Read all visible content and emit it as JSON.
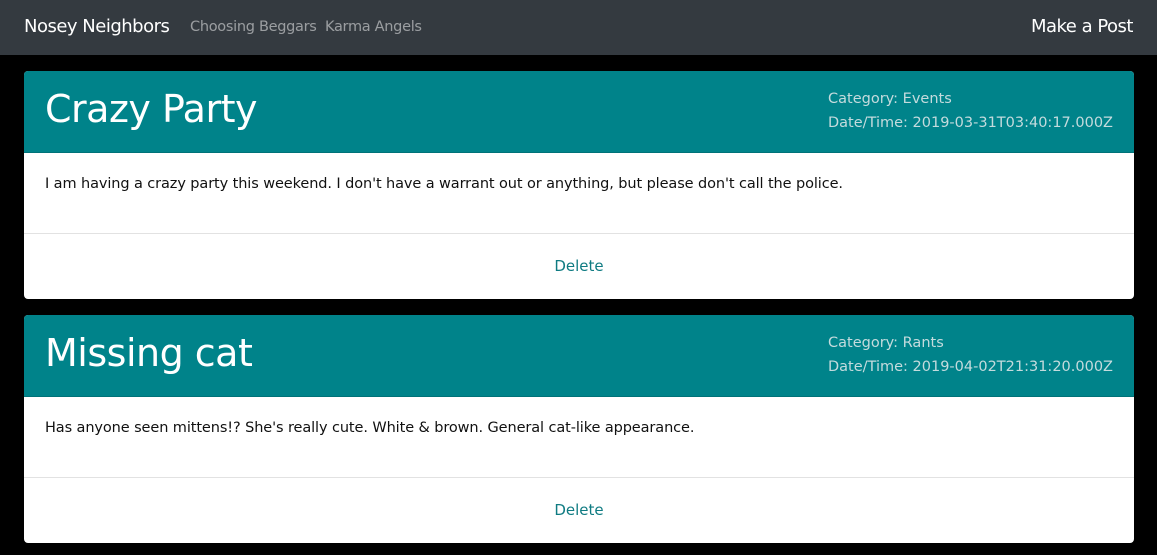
{
  "navbar": {
    "brand": "Nosey Neighbors",
    "links": [
      "Choosing Beggars",
      "Karma Angels"
    ],
    "make_post": "Make a Post"
  },
  "posts": [
    {
      "title": "Crazy Party",
      "category_label": "Category: Events",
      "datetime_label": "Date/Time: 2019-03-31T03:40:17.000Z",
      "body": "I am having a crazy party this weekend. I don't have a warrant out or anything, but please don't call the police.",
      "delete_label": "Delete"
    },
    {
      "title": "Missing cat",
      "category_label": "Category: Rants",
      "datetime_label": "Date/Time: 2019-04-02T21:31:20.000Z",
      "body": "Has anyone seen mittens!? She's really cute. White & brown. General cat-like appearance.",
      "delete_label": "Delete"
    }
  ],
  "colors": {
    "navbar_bg": "#343a40",
    "card_header_bg": "#00838a",
    "link": "#0f7b82",
    "page_bg": "#000000"
  }
}
